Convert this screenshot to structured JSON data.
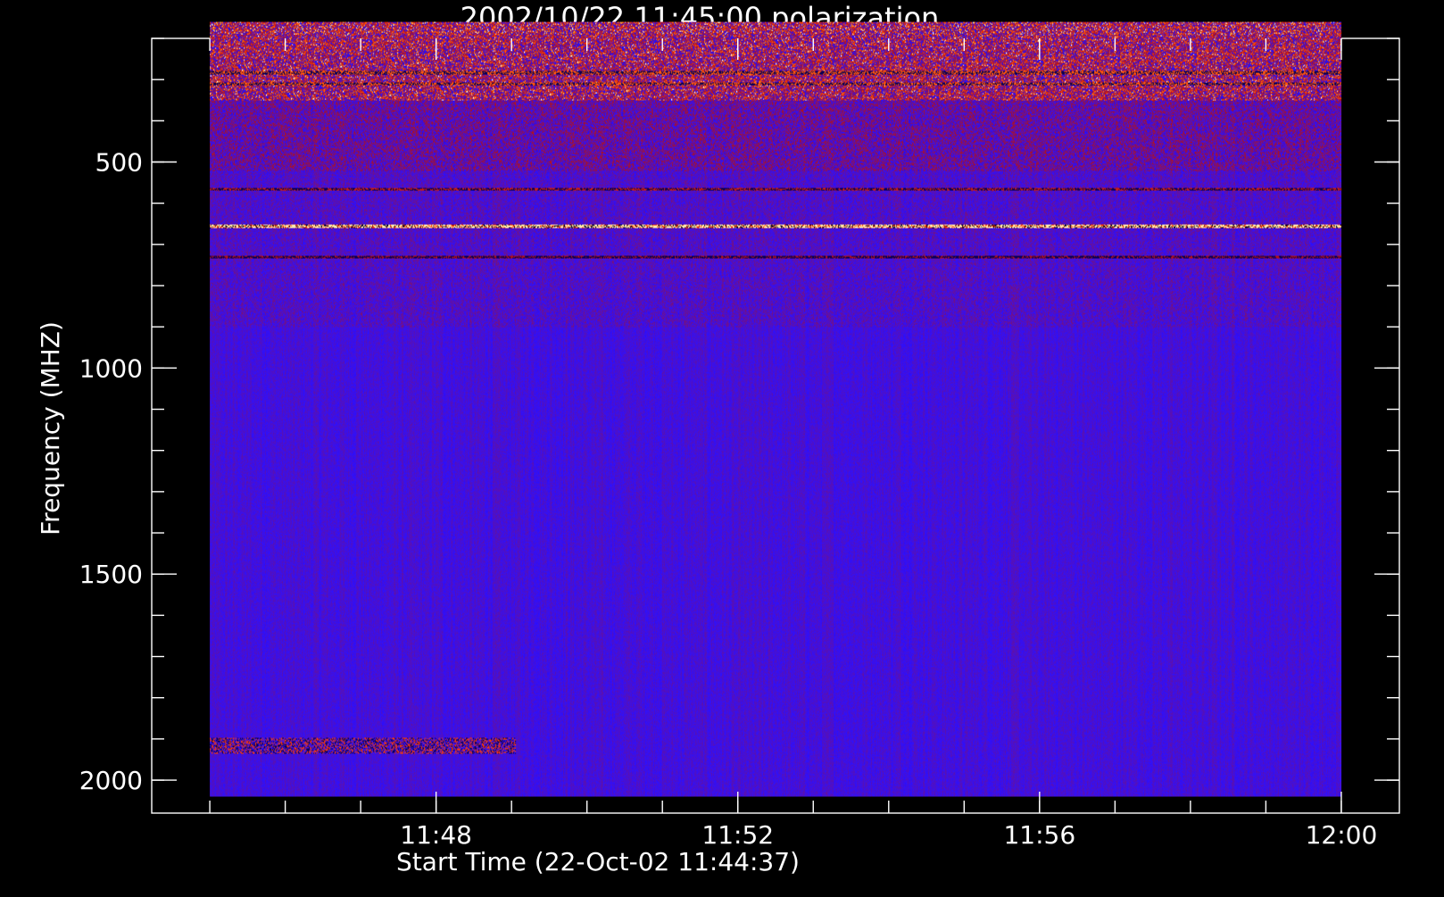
{
  "chart_data": {
    "type": "heatmap",
    "title": "2002/10/22 11:45:00 polarization",
    "xlabel": "Start Time (22-Oct-02 11:44:37)",
    "ylabel": "Frequency (MHZ)",
    "x_range": [
      "11:44:37",
      "12:00:00"
    ],
    "x_axis_range_minutes": [
      -0.77,
      15.77
    ],
    "data_time_range": [
      "11:45:00",
      "12:00:00"
    ],
    "ylim": [
      2080,
      200
    ],
    "data_frequency_range": [
      160,
      2040
    ],
    "x_major_ticks": [
      "11:48",
      "11:52",
      "11:56",
      "12:00"
    ],
    "x_minor_tick_interval_minutes": 1,
    "y_major_ticks": [
      500,
      1000,
      1500,
      2000
    ],
    "y_minor_tick_interval": 100,
    "grid": false,
    "colormap": [
      "#000000",
      "#1a00d0",
      "#2e10ff",
      "#b0101a",
      "#ff3a00",
      "#ffcc40",
      "#ffffff"
    ],
    "background_color": "#000000",
    "features": [
      {
        "kind": "strong emission band",
        "frequency_range": [
          220,
          350
        ],
        "time_range": [
          "11:45:00",
          "12:00:00"
        ]
      },
      {
        "kind": "diffuse emission",
        "frequency_range": [
          350,
          520
        ],
        "time_range": [
          "11:45:00",
          "12:00:00"
        ]
      },
      {
        "kind": "bright narrow line",
        "frequency": 655
      },
      {
        "kind": "dark narrow line",
        "frequency": 730
      },
      {
        "kind": "narrow line",
        "frequency": 565
      },
      {
        "kind": "intermittent features",
        "frequency_range": [
          1900,
          1935
        ],
        "time_range": [
          "11:45:00",
          "11:49:00"
        ]
      }
    ]
  }
}
